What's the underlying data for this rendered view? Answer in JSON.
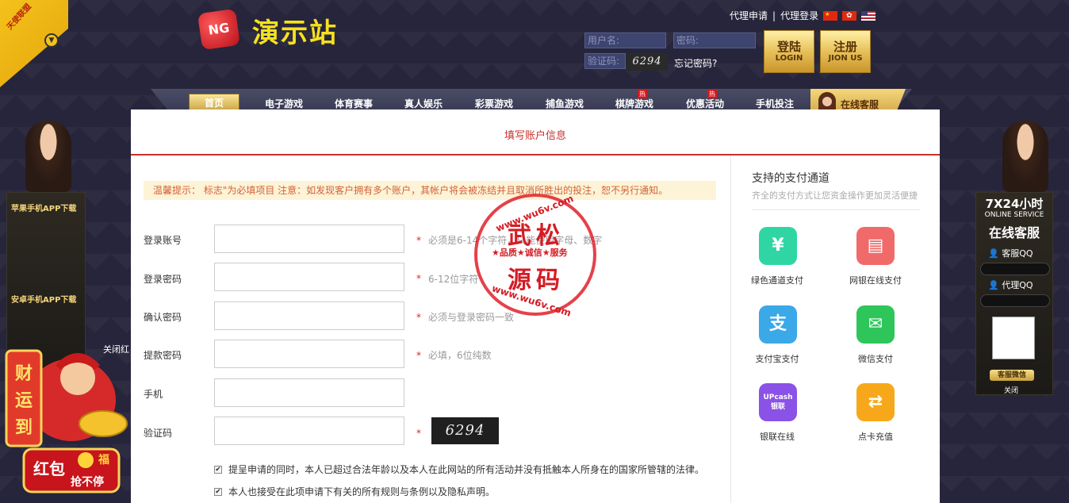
{
  "header": {
    "ribbon_text": "天使联盟",
    "logo_badge": "NG",
    "logo_text": "演示站",
    "agent_apply": "代理申请",
    "agent_login": "代理登录",
    "separator": "|",
    "username_placeholder": "用户名:",
    "password_placeholder": "密码:",
    "captcha_placeholder": "验证码:",
    "captcha_code": "6294",
    "forgot": "忘记密码?",
    "login_cn": "登陆",
    "login_en": "LOGIN",
    "join_cn": "注册",
    "join_en": "JION US"
  },
  "nav": {
    "items": [
      "首页",
      "电子游戏",
      "体育赛事",
      "真人娱乐",
      "彩票游戏",
      "捕鱼游戏",
      "棋牌游戏",
      "优惠活动",
      "手机投注"
    ],
    "hot_label": "热",
    "kefu": "在线客服"
  },
  "form": {
    "title": "填写账户信息",
    "notice": "温馨提示： 标志\"为必填项目 注意：如发现客户拥有多个账户，其帐户将会被冻结并且取消所胜出的投注，恕不另行通知。",
    "required_mark": "*",
    "fields": [
      {
        "label": "登录账号",
        "hint": "必须是6-14个字符，只能使用字母、数字"
      },
      {
        "label": "登录密码",
        "hint": "6-12位字符"
      },
      {
        "label": "确认密码",
        "hint": "必须与登录密码一致"
      },
      {
        "label": "提款密码",
        "hint": "必填，6位纯数"
      },
      {
        "label": "手机",
        "hint": ""
      },
      {
        "label": "验证码",
        "hint": ""
      }
    ],
    "captcha_code": "6294",
    "check_mark": "✔",
    "agree1": "提呈申请的同时，本人已超过合法年龄以及本人在此网站的所有活动并没有抵触本人所身在的国家所管辖的法律。",
    "agree2": "本人也接受在此项申请下有关的所有规则与条例以及隐私声明。"
  },
  "payment": {
    "title": "支持的支付通道",
    "subtitle": "齐全的支付方式让您资金操作更加灵活便捷",
    "methods": [
      {
        "label": "绿色通道支付",
        "glyph": "¥",
        "color": "#2fd6a4"
      },
      {
        "label": "网银在线支付",
        "glyph": "▤",
        "color": "#f06a6a"
      },
      {
        "label": "支付宝支付",
        "glyph": "支",
        "color": "#3ba8e8"
      },
      {
        "label": "微信支付",
        "glyph": "✉",
        "color": "#2ec65a"
      },
      {
        "label": "银联在线",
        "glyph": "UPcash 银联",
        "color": "#8a52e6"
      },
      {
        "label": "点卡充值",
        "glyph": "⇄",
        "color": "#f7a81a"
      }
    ]
  },
  "stamp": {
    "url_top": "www.wu6v.com",
    "chars_top": "武松",
    "middle": "★品质★诚信★服务",
    "chars_bottom": "源码",
    "url_bottom": "www.wu6v.com"
  },
  "left_side": {
    "iphone_app": "苹果手机APP下载",
    "android_app": "安卓手机APP下载",
    "close_hongbao": "关闭红",
    "promo_top": "财运到",
    "promo_bottom": "红包",
    "promo_tag": "抢不停",
    "promo_fu": "福"
  },
  "right_side": {
    "hours": "7X24小时",
    "online_service": "ONLINE SERVICE",
    "service_cn": "在线客服",
    "qq1": "客服QQ",
    "qq2": "代理QQ",
    "weixin": "客服微信",
    "close": "关闭"
  }
}
